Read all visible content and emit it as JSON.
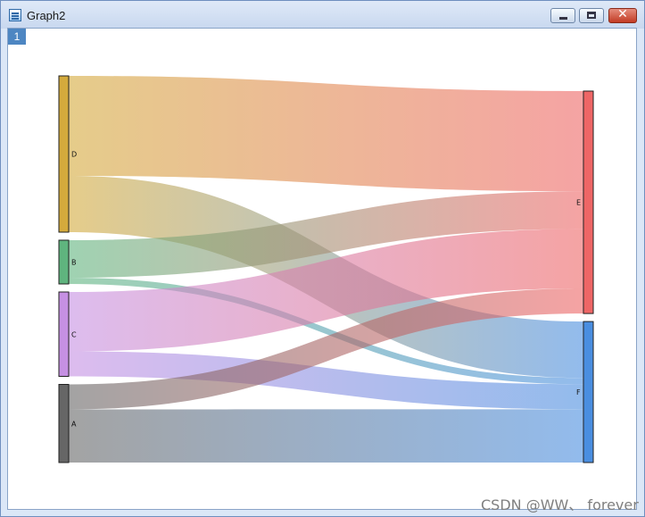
{
  "window": {
    "title": "Graph2",
    "layer_tab": "1",
    "close_glyph": "✕"
  },
  "chart_data": {
    "type": "sankey",
    "title": "",
    "nodes": [
      {
        "id": "D",
        "column": 0,
        "color": "#d4aa3c"
      },
      {
        "id": "B",
        "column": 0,
        "color": "#5fb47e"
      },
      {
        "id": "C",
        "column": 0,
        "color": "#c690e3"
      },
      {
        "id": "A",
        "column": 0,
        "color": "#666666"
      },
      {
        "id": "E",
        "column": 1,
        "color": "#ee6666"
      },
      {
        "id": "F",
        "column": 1,
        "color": "#4a8ee0"
      }
    ],
    "links": [
      {
        "source": "D",
        "target": "E",
        "value": 32
      },
      {
        "source": "D",
        "target": "F",
        "value": 18
      },
      {
        "source": "B",
        "target": "E",
        "value": 12
      },
      {
        "source": "B",
        "target": "F",
        "value": 2
      },
      {
        "source": "C",
        "target": "E",
        "value": 19
      },
      {
        "source": "C",
        "target": "F",
        "value": 8
      },
      {
        "source": "A",
        "target": "E",
        "value": 8
      },
      {
        "source": "A",
        "target": "F",
        "value": 17
      }
    ]
  },
  "watermark": "CSDN @WW、 forever"
}
